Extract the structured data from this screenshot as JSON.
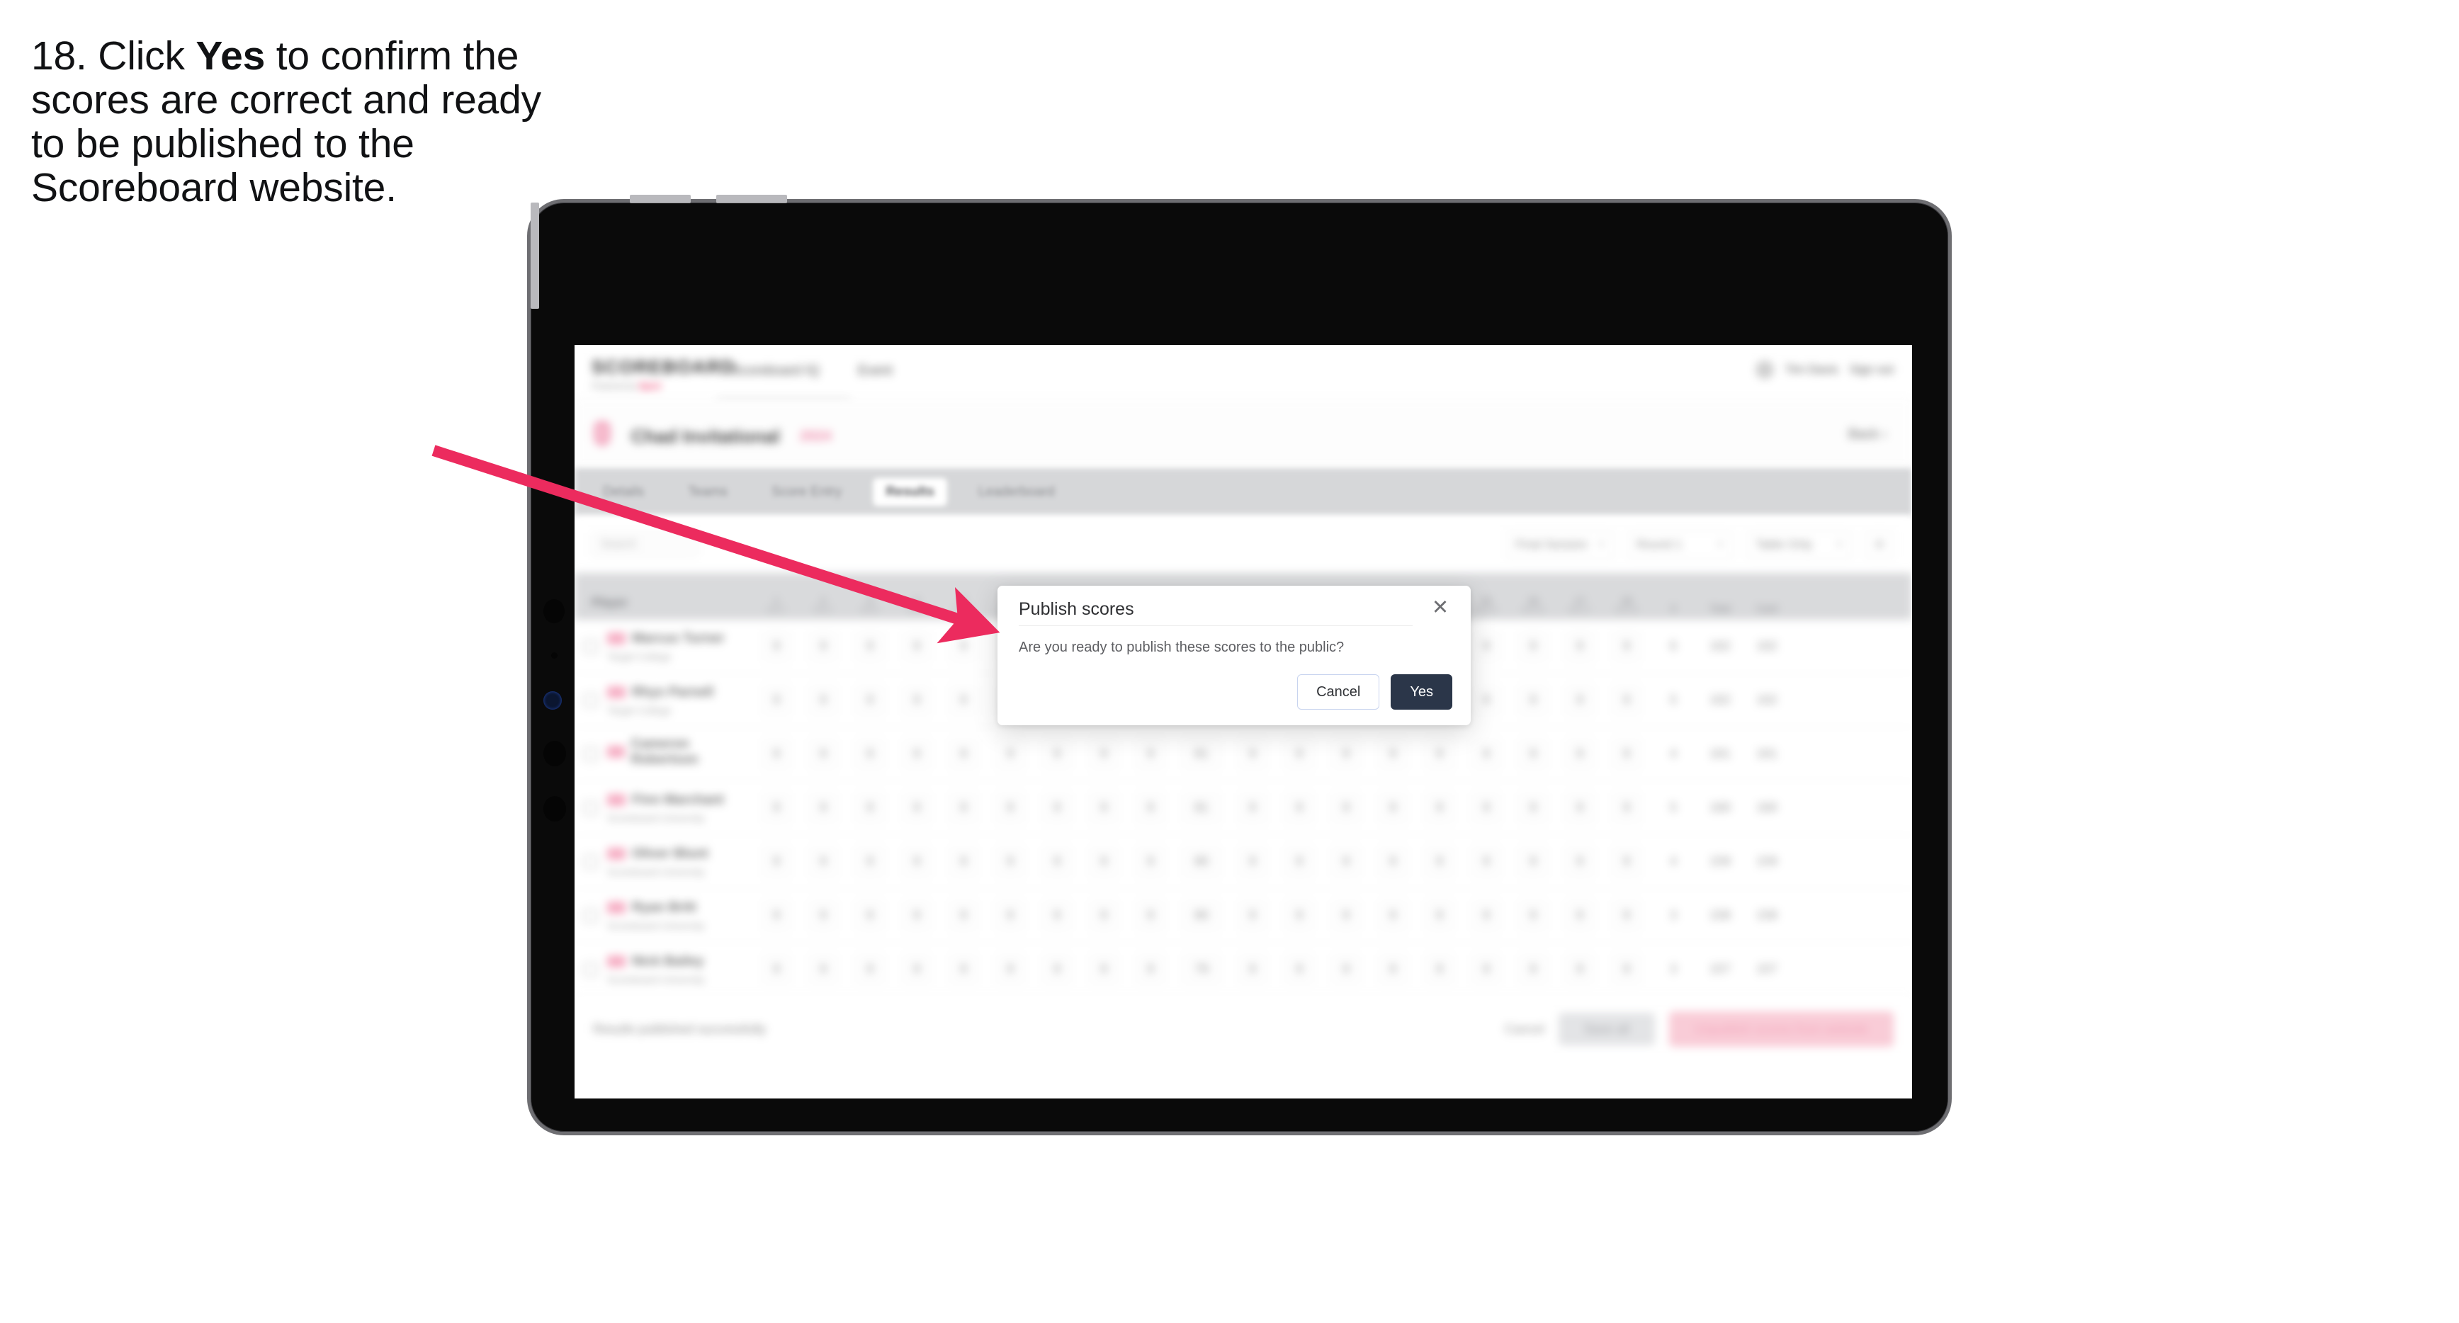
{
  "instruction": {
    "step_prefix": "18. Click ",
    "emphasis": "Yes",
    "rest": " to confirm the scores are correct and ready to be published to the Scoreboard website."
  },
  "colors": {
    "arrow": "#ec2b5e",
    "accent_pink": "#ec2b5e",
    "primary_button": "#2b3649",
    "tab_bar": "#d6d7d9",
    "table_header": "#d9dadc"
  },
  "app": {
    "topbar": {
      "logo_wordmark": "SCOREBOARD",
      "logo_sub_prefix": "Powered by ",
      "logo_sub_accent": "Sport",
      "nav": [
        {
          "label": "Scoreboard IQ"
        },
        {
          "label": "Event"
        }
      ],
      "user": {
        "avatar": "user-avatar",
        "name": "Tim Davis",
        "signout": "Sign out"
      }
    },
    "event_header": {
      "icon": "trophy-icon",
      "title": "Chad Invitational",
      "chip": "2024",
      "back_label": "Back  ›"
    },
    "tabs": [
      {
        "label": "Details",
        "active": false
      },
      {
        "label": "Teams",
        "active": false
      },
      {
        "label": "Score Entry",
        "active": false
      },
      {
        "label": "Results",
        "active": true
      },
      {
        "label": "Leaderboard",
        "active": false
      }
    ],
    "filters": {
      "search_placeholder": "Search",
      "selects": [
        {
          "label": "Final Session"
        },
        {
          "label": "Round 1"
        },
        {
          "label": "Table Only"
        }
      ],
      "icon_button": "filter-icon"
    },
    "table": {
      "columns": [
        {
          "key": "player",
          "label": "Player",
          "type": "player"
        },
        {
          "key": "c1",
          "num": "1",
          "sub": "End 1",
          "type": "num"
        },
        {
          "key": "c2",
          "num": "2",
          "sub": "End 2",
          "type": "num"
        },
        {
          "key": "c3",
          "num": "3",
          "sub": "End 3",
          "type": "num"
        },
        {
          "key": "c4",
          "num": "4",
          "sub": "End 4",
          "type": "num"
        },
        {
          "key": "c5",
          "num": "5",
          "sub": "End 5",
          "type": "num"
        },
        {
          "key": "c6",
          "num": "6",
          "sub": "End 6",
          "type": "num"
        },
        {
          "key": "c7",
          "num": "7",
          "sub": "End 7",
          "type": "num"
        },
        {
          "key": "c8",
          "num": "8",
          "sub": "End 8",
          "type": "num"
        },
        {
          "key": "c9",
          "num": "9",
          "sub": "End 9",
          "type": "num"
        },
        {
          "key": "sub1",
          "num": "Sub",
          "sub": "Total",
          "type": "wide"
        },
        {
          "key": "c10",
          "num": "10",
          "sub": "End 10",
          "type": "num"
        },
        {
          "key": "c11",
          "num": "11",
          "sub": "End 11",
          "type": "num"
        },
        {
          "key": "c12",
          "num": "12",
          "sub": "End 12",
          "type": "num"
        },
        {
          "key": "c13",
          "num": "13",
          "sub": "End 13",
          "type": "num"
        },
        {
          "key": "c14",
          "num": "14",
          "sub": "End 14",
          "type": "num"
        },
        {
          "key": "c15",
          "num": "15",
          "sub": "End 15",
          "type": "num"
        },
        {
          "key": "c16",
          "num": "16",
          "sub": "End 16",
          "type": "num"
        },
        {
          "key": "c17",
          "num": "17",
          "sub": "End 17",
          "type": "num"
        },
        {
          "key": "c18",
          "num": "18",
          "sub": "End 18",
          "type": "num"
        },
        {
          "key": "x",
          "num": "X",
          "sub": "",
          "type": "tail"
        },
        {
          "key": "tot",
          "num": "Total",
          "sub": "",
          "type": "tail"
        },
        {
          "key": "card",
          "num": "Card",
          "sub": "",
          "type": "tail"
        }
      ],
      "rows": [
        {
          "name": "Marcus Turner",
          "club": "Target College",
          "scores": [
            "9",
            "9",
            "9",
            "9",
            "9",
            "9",
            "9",
            "9",
            "9"
          ],
          "sub": "81",
          "scores2": [
            "9",
            "9",
            "9",
            "9",
            "9",
            "9",
            "9",
            "9",
            "9"
          ],
          "x": "6",
          "total": "162",
          "card": "162"
        },
        {
          "name": "Rhys Parnell",
          "club": "Target College",
          "scores": [
            "9",
            "9",
            "9",
            "9",
            "9",
            "9",
            "9",
            "9",
            "9"
          ],
          "sub": "81",
          "scores2": [
            "9",
            "9",
            "9",
            "9",
            "9",
            "9",
            "9",
            "9",
            "9"
          ],
          "x": "5",
          "total": "162",
          "card": "162"
        },
        {
          "name": "Cameron Robertson",
          "club": "",
          "scores": [
            "9",
            "9",
            "9",
            "9",
            "9",
            "9",
            "9",
            "9",
            "9"
          ],
          "sub": "81",
          "scores2": [
            "9",
            "9",
            "9",
            "9",
            "9",
            "9",
            "9",
            "9",
            "9"
          ],
          "x": "4",
          "total": "161",
          "card": "161"
        },
        {
          "name": "Finn Marchant",
          "club": "Scoreboard University",
          "scores": [
            "9",
            "9",
            "9",
            "9",
            "9",
            "9",
            "9",
            "9",
            "9"
          ],
          "sub": "81",
          "scores2": [
            "9",
            "9",
            "9",
            "9",
            "9",
            "9",
            "9",
            "9",
            "9"
          ],
          "x": "5",
          "total": "160",
          "card": "160"
        },
        {
          "name": "Oliver Blunt",
          "club": "Scoreboard University",
          "scores": [
            "9",
            "9",
            "9",
            "9",
            "9",
            "9",
            "9",
            "9",
            "9"
          ],
          "sub": "80",
          "scores2": [
            "9",
            "9",
            "9",
            "9",
            "9",
            "9",
            "9",
            "9",
            "9"
          ],
          "x": "4",
          "total": "159",
          "card": "159"
        },
        {
          "name": "Ryan Britt",
          "club": "Scoreboard University",
          "scores": [
            "9",
            "9",
            "9",
            "9",
            "9",
            "9",
            "9",
            "9",
            "9"
          ],
          "sub": "80",
          "scores2": [
            "9",
            "9",
            "9",
            "9",
            "9",
            "9",
            "9",
            "9",
            "9"
          ],
          "x": "3",
          "total": "158",
          "card": "158"
        },
        {
          "name": "Nick Bailey",
          "club": "Scoreboard University",
          "scores": [
            "9",
            "9",
            "9",
            "9",
            "9",
            "9",
            "9",
            "9",
            "9"
          ],
          "sub": "79",
          "scores2": [
            "9",
            "9",
            "9",
            "9",
            "9",
            "9",
            "9",
            "9",
            "9"
          ],
          "x": "3",
          "total": "157",
          "card": "157"
        }
      ]
    },
    "footer": {
      "note": "Results published successfully",
      "link": "Cancel",
      "grey_button": "Save all",
      "pink_button": "Unpublish scores from website"
    }
  },
  "modal": {
    "title": "Publish scores",
    "close_icon": "close-icon",
    "body": "Are you ready to publish these scores to the public?",
    "cancel_label": "Cancel",
    "confirm_label": "Yes"
  }
}
